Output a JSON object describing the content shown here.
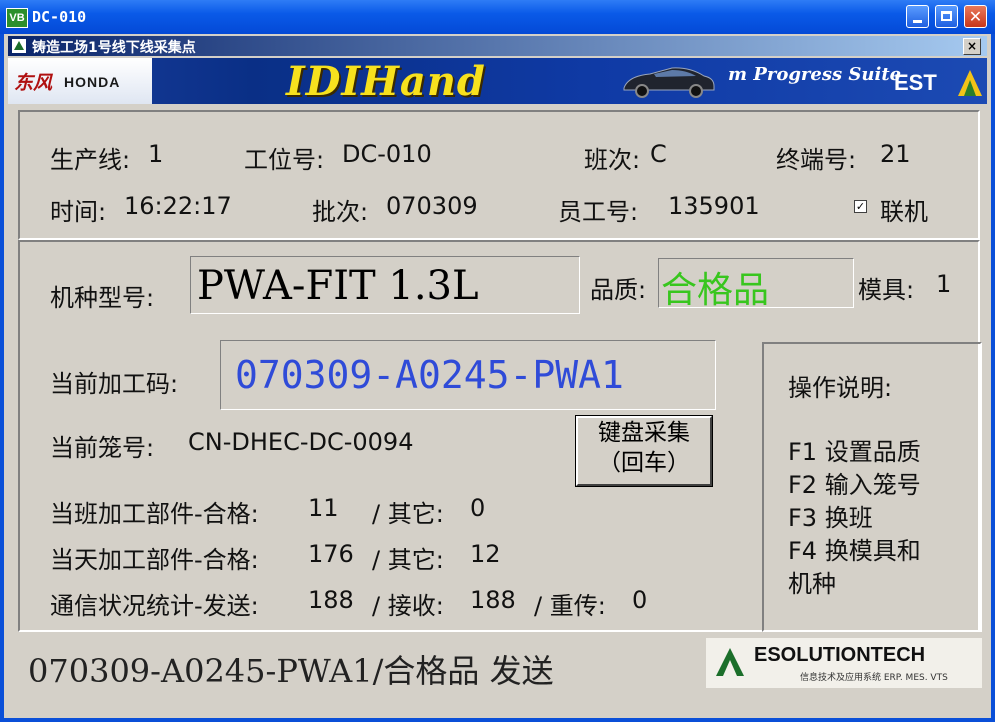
{
  "window": {
    "title": "DC-010",
    "app_icon": "VB"
  },
  "subwindow": {
    "title": "铸造工场1号线下线采集点",
    "close": "×"
  },
  "banner": {
    "brand_cn": "东风",
    "brand_en": "HONDA",
    "product": "IDIHand",
    "suite": "m Progress Suite",
    "company": "EST"
  },
  "info": {
    "line_label": "生产线:",
    "line_value": "1",
    "station_label": "工位号:",
    "station_value": "DC-010",
    "shift_label": "班次:",
    "shift_value": "C",
    "terminal_label": "终端号:",
    "terminal_value": "21",
    "time_label": "时间:",
    "time_value": "16:22:17",
    "batch_label": "批次:",
    "batch_value": "070309",
    "employee_label": "员工号:",
    "employee_value": "135901",
    "online_label": "联机",
    "online_checked": true
  },
  "model": {
    "label": "机种型号:",
    "value": "PWA-FIT 1.3L",
    "quality_label": "品质:",
    "quality_value": "合格品",
    "quality_color": "#38c61e",
    "mold_label": "模具:",
    "mold_value": "1"
  },
  "current": {
    "code_label": "当前加工码:",
    "code_value": "070309-A0245-PWA1",
    "code_color": "#2f4bd8",
    "basket_label": "当前笼号:",
    "basket_value": "CN-DHEC-DC-0094"
  },
  "collect_button": {
    "line1": "键盘采集",
    "line2": "（回车）"
  },
  "stats": {
    "shift_label": "当班加工部件-合格:",
    "shift_ok": "11",
    "shift_other_label": "/ 其它:",
    "shift_other": "0",
    "day_label": "当天加工部件-合格:",
    "day_ok": "176",
    "day_other_label": "/ 其它:",
    "day_other": "12",
    "comm_label": "通信状况统计-发送:",
    "sent": "188",
    "recv_label": "/ 接收:",
    "recv": "188",
    "resend_label": "/ 重传:",
    "resend": "0"
  },
  "help": {
    "title": "操作说明:",
    "items": [
      "F1 设置品质",
      "F2 输入笼号",
      "F3 换班",
      "F4 换模具和",
      "机种"
    ]
  },
  "status_bar": {
    "text": "070309-A0245-PWA1/合格品 发送"
  },
  "footer_logo": {
    "name": "ESOLUTIONTECH",
    "tagline": "信息技术及应用系统 ERP. MES. VTS"
  }
}
